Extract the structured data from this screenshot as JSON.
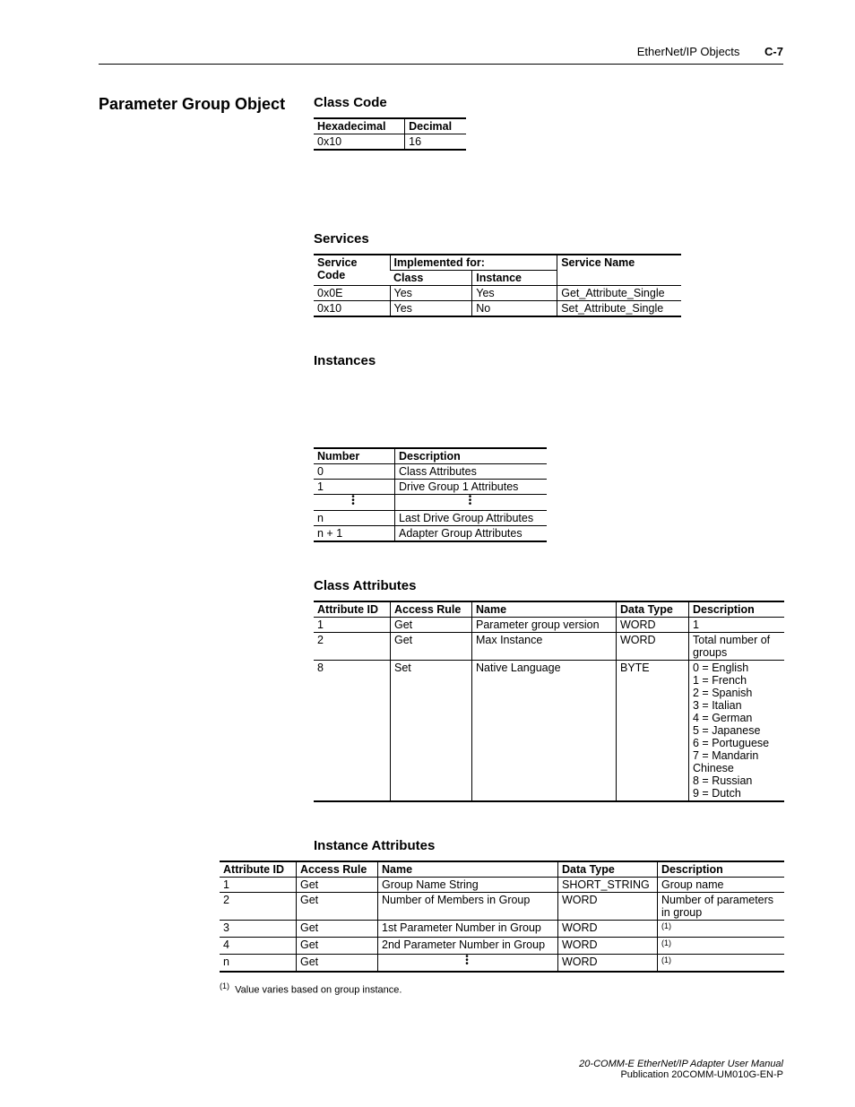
{
  "header": {
    "title": "EtherNet/IP Objects",
    "page": "C-7"
  },
  "left": {
    "title": "Parameter Group Object"
  },
  "classcode": {
    "heading": "Class Code",
    "cols": [
      "Hexadecimal",
      "Decimal"
    ],
    "rows": [
      [
        "0x10",
        "16"
      ]
    ]
  },
  "services": {
    "heading": "Services",
    "h_service": "Service Code",
    "h_impl": "Implemented for:",
    "h_class": "Class",
    "h_instance": "Instance",
    "h_name": "Service Name",
    "rows": [
      [
        "0x0E",
        "Yes",
        "Yes",
        "Get_Attribute_Single"
      ],
      [
        "0x10",
        "Yes",
        "No",
        "Set_Attribute_Single"
      ]
    ]
  },
  "instances": {
    "heading": "Instances",
    "cols": [
      "Number",
      "Description"
    ],
    "rows": [
      [
        "0",
        "Class Attributes"
      ],
      [
        "1",
        "Drive Group 1 Attributes"
      ],
      [
        "VDOTS",
        "VDOTS"
      ],
      [
        "n",
        "Last Drive Group Attributes"
      ],
      [
        "n + 1",
        "Adapter Group Attributes"
      ]
    ]
  },
  "classattr": {
    "heading": "Class Attributes",
    "cols": [
      "Attribute ID",
      "Access Rule",
      "Name",
      "Data Type",
      "Description"
    ],
    "rows": [
      [
        "1",
        "Get",
        "Parameter group version",
        "WORD",
        "1"
      ],
      [
        "2",
        "Get",
        "Max Instance",
        "WORD",
        "Total number of groups"
      ],
      [
        "8",
        "Set",
        "Native Language",
        "BYTE",
        "0 = English\n1 = French\n2 = Spanish\n3 = Italian\n4 = German\n5 = Japanese\n6 = Portuguese\n7 = Mandarin Chinese\n8 = Russian\n9 = Dutch"
      ]
    ]
  },
  "instattr": {
    "heading": "Instance Attributes",
    "cols": [
      "Attribute ID",
      "Access Rule",
      "Name",
      "Data Type",
      "Description"
    ],
    "rows": [
      [
        "1",
        "Get",
        "Group Name String",
        "SHORT_STRING",
        "Group name"
      ],
      [
        "2",
        "Get",
        "Number of Members in Group",
        "WORD",
        "Number of parameters in group"
      ],
      [
        "3",
        "Get",
        "1st Parameter Number in Group",
        "WORD",
        "SUP1"
      ],
      [
        "4",
        "Get",
        "2nd Parameter Number in Group",
        "WORD",
        "SUP1"
      ],
      [
        "n",
        "Get",
        "VDOTS",
        "WORD",
        "SUP1"
      ]
    ],
    "footnote_marker": "(1)",
    "footnote_text": "Value varies based on group instance."
  },
  "footer": {
    "line1": "20-COMM-E EtherNet/IP Adapter User Manual",
    "line2": "Publication 20COMM-UM010G-EN-P"
  }
}
